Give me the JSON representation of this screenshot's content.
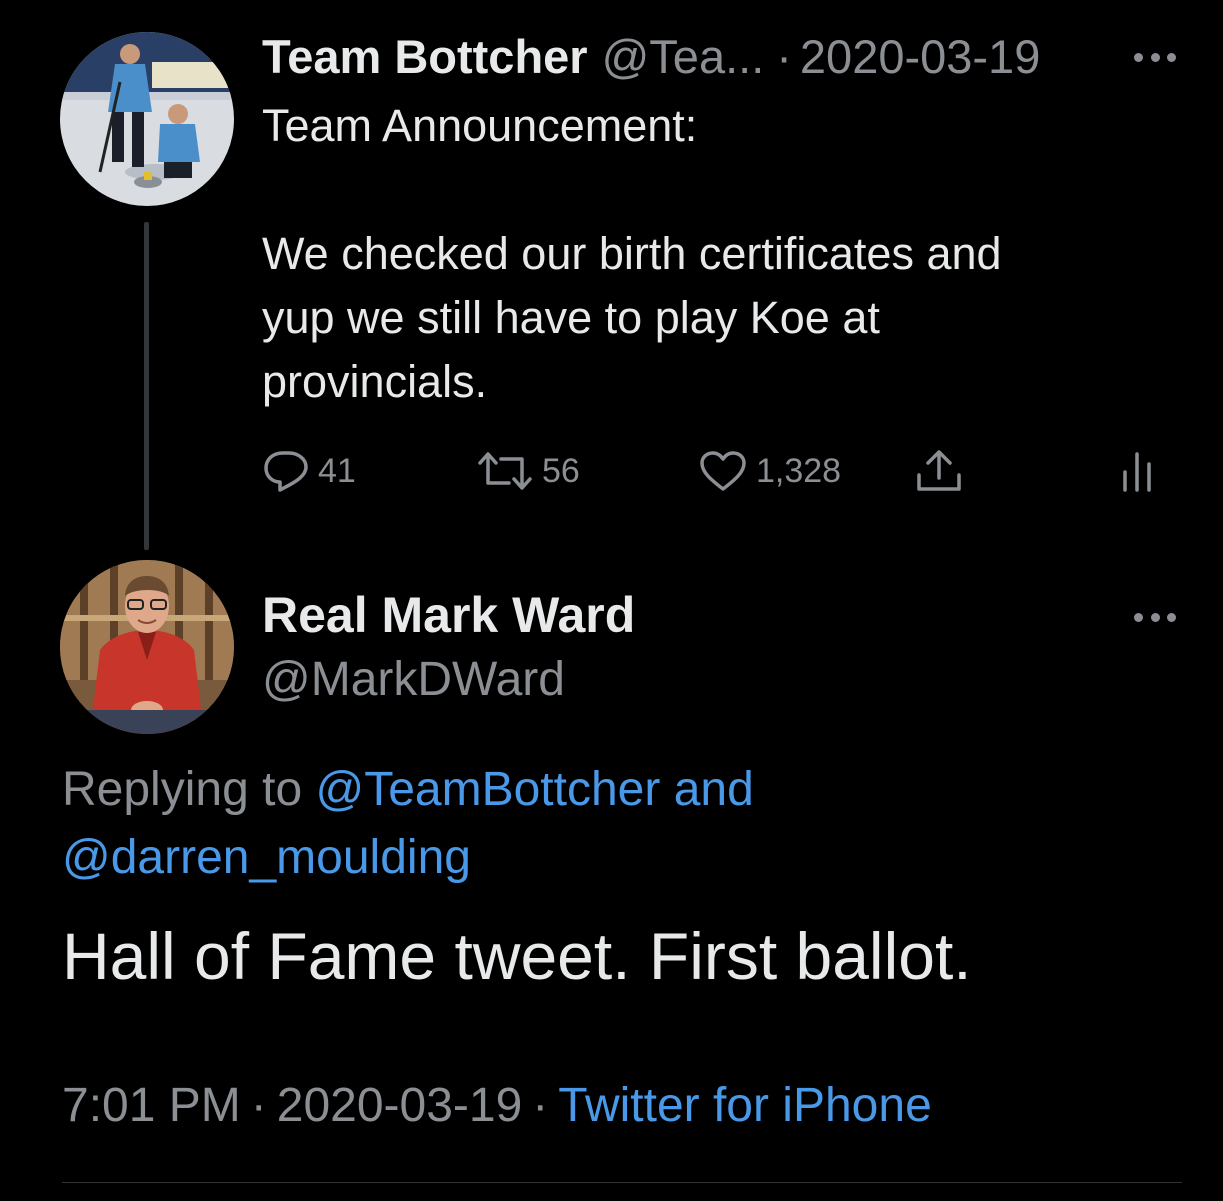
{
  "tweet": {
    "author": {
      "name": "Team Bottcher",
      "handle": "@Tea...",
      "avatar": "curling-team-photo"
    },
    "date_separator": "·",
    "date": "2020-03-19",
    "text_lines": [
      "Team Announcement:",
      "We checked our birth certificates and",
      "yup we still have to play Koe at",
      "provincials."
    ],
    "actions": {
      "reply_count": "41",
      "retweet_count": "56",
      "like_count": "1,328"
    }
  },
  "reply": {
    "author": {
      "name": "Real Mark Ward",
      "handle": "@MarkDWard",
      "avatar": "man-in-red-jacket-photo"
    },
    "replying_prefix": "Replying to",
    "replying_user_1": "@TeamBottcher",
    "replying_and": "and",
    "replying_user_2": "@darren_moulding",
    "text": "Hall of Fame tweet. First ballot.",
    "time": "7:01 PM",
    "separator": "·",
    "date": "2020-03-19",
    "source": "Twitter for iPhone"
  },
  "icons": {
    "reply": "reply-icon",
    "retweet": "retweet-icon",
    "like": "heart-icon",
    "share": "share-icon",
    "analytics": "analytics-icon",
    "more": "more-icon"
  },
  "colors": {
    "background": "#000000",
    "text": "#e7e9ea",
    "secondary": "#8b8f94",
    "link": "#4a99e9",
    "thread_line": "#333639"
  }
}
